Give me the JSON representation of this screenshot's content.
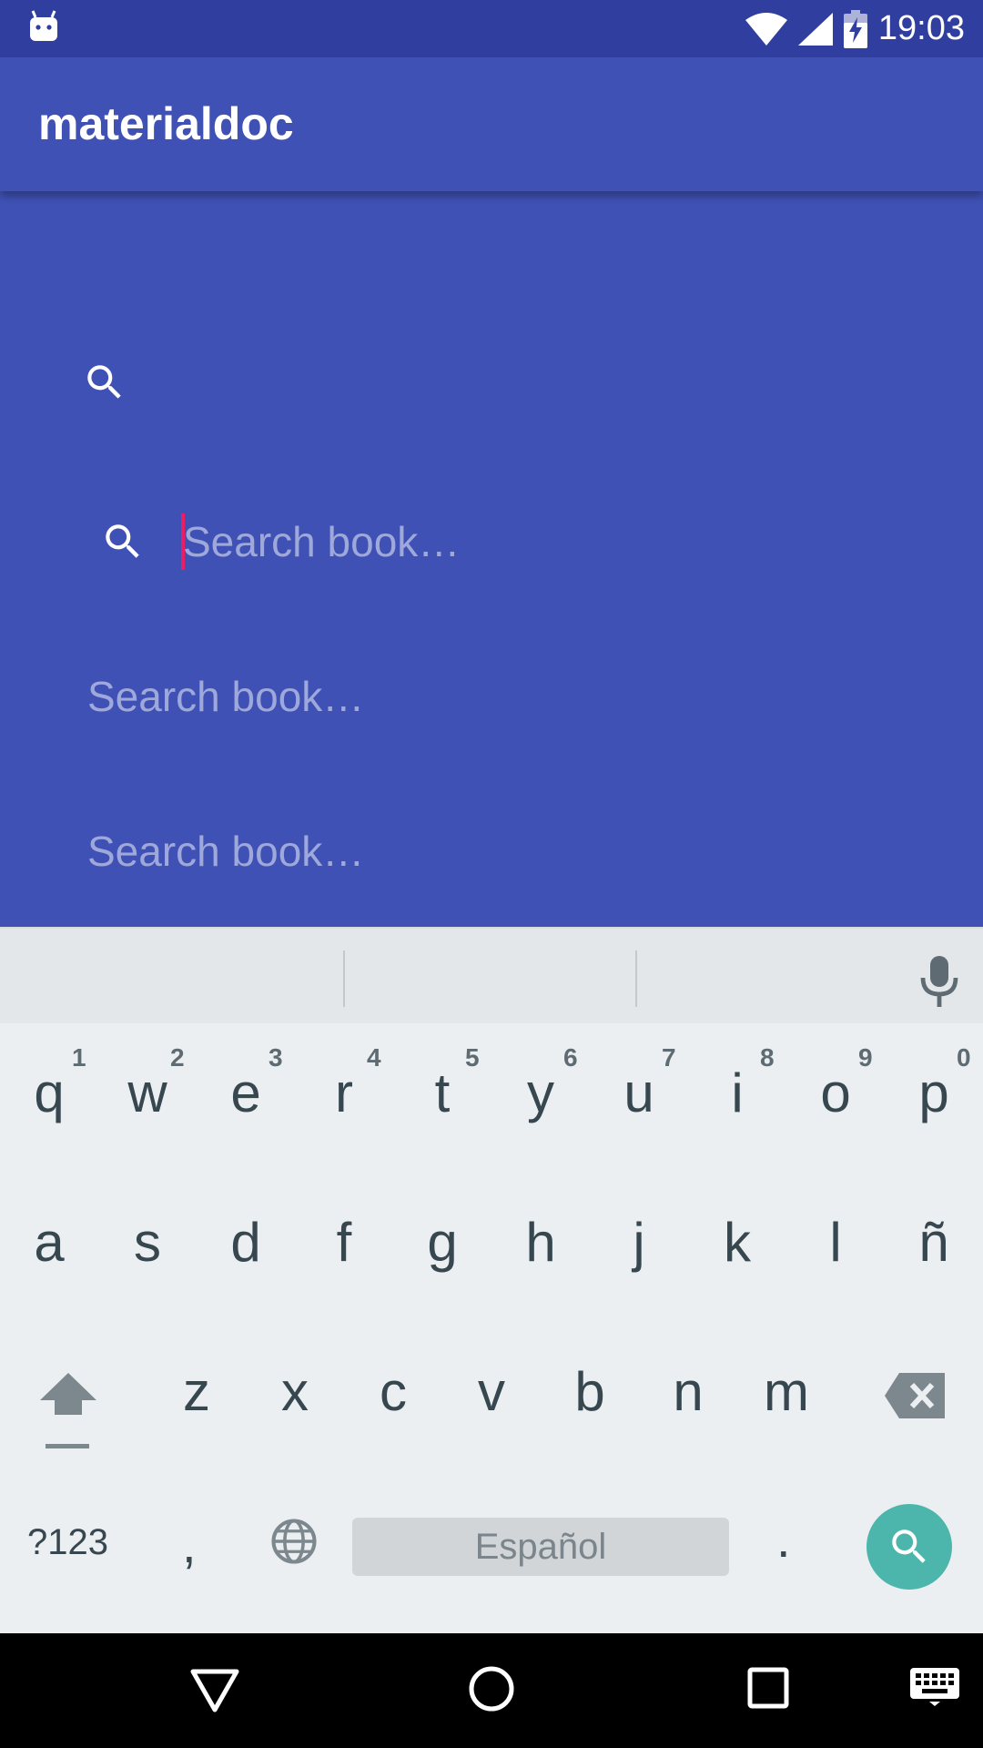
{
  "status_bar": {
    "time": "19:03",
    "icons": [
      "android-icon",
      "wifi-icon",
      "signal-icon",
      "battery-charging-icon"
    ]
  },
  "app_bar": {
    "title": "materialdoc"
  },
  "search": {
    "active_placeholder": "Search book…",
    "field_2": "Search book…",
    "field_3": "Search book…"
  },
  "keyboard": {
    "row1": [
      "q",
      "w",
      "e",
      "r",
      "t",
      "y",
      "u",
      "i",
      "o",
      "p"
    ],
    "row1_hints": [
      "1",
      "2",
      "3",
      "4",
      "5",
      "6",
      "7",
      "8",
      "9",
      "0"
    ],
    "row2": [
      "a",
      "s",
      "d",
      "f",
      "g",
      "h",
      "j",
      "k",
      "l",
      "ñ"
    ],
    "row3": [
      "z",
      "x",
      "c",
      "v",
      "b",
      "n",
      "m"
    ],
    "symbols_label": "?123",
    "comma": ",",
    "period": ".",
    "space_label": "Español",
    "action_icon": "search-icon",
    "action_color": "#4DB6AC"
  },
  "colors": {
    "primary": "#3F51B5",
    "primary_dark": "#303F9F",
    "accent": "#E91E63"
  },
  "nav_bar": {
    "icons": [
      "back-icon",
      "home-icon",
      "recents-icon",
      "keyboard-icon"
    ]
  }
}
